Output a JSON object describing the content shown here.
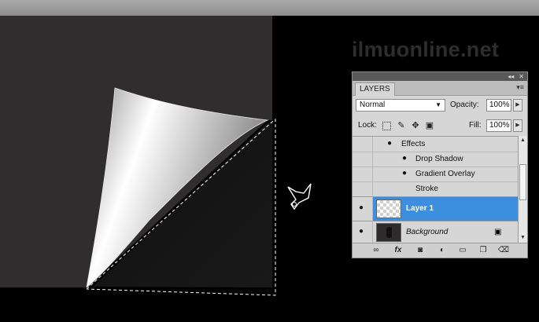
{
  "watermark": "ilmuonline.net",
  "layers_panel": {
    "collapse_glyph": "◂◂",
    "close_glyph": "✕",
    "tab_label": "LAYERS",
    "menu_icon": "panel-menu-icon",
    "blend_mode": "Normal",
    "opacity_label": "Opacity:",
    "opacity_value": "100%",
    "lock_label": "Lock:",
    "fill_label": "Fill:",
    "fill_value": "100%",
    "effects": {
      "header": "Effects",
      "items": [
        {
          "label": "Drop Shadow",
          "visible": true
        },
        {
          "label": "Gradient Overlay",
          "visible": true
        },
        {
          "label": "Stroke",
          "visible": false
        }
      ]
    },
    "layers": [
      {
        "name": "Layer 1",
        "selected": true,
        "visible": true
      },
      {
        "name": "Background",
        "selected": false,
        "visible": true,
        "locked": true
      }
    ],
    "colors": {
      "selected": "#3c8fdf",
      "panel": "#d6d6d6"
    }
  }
}
